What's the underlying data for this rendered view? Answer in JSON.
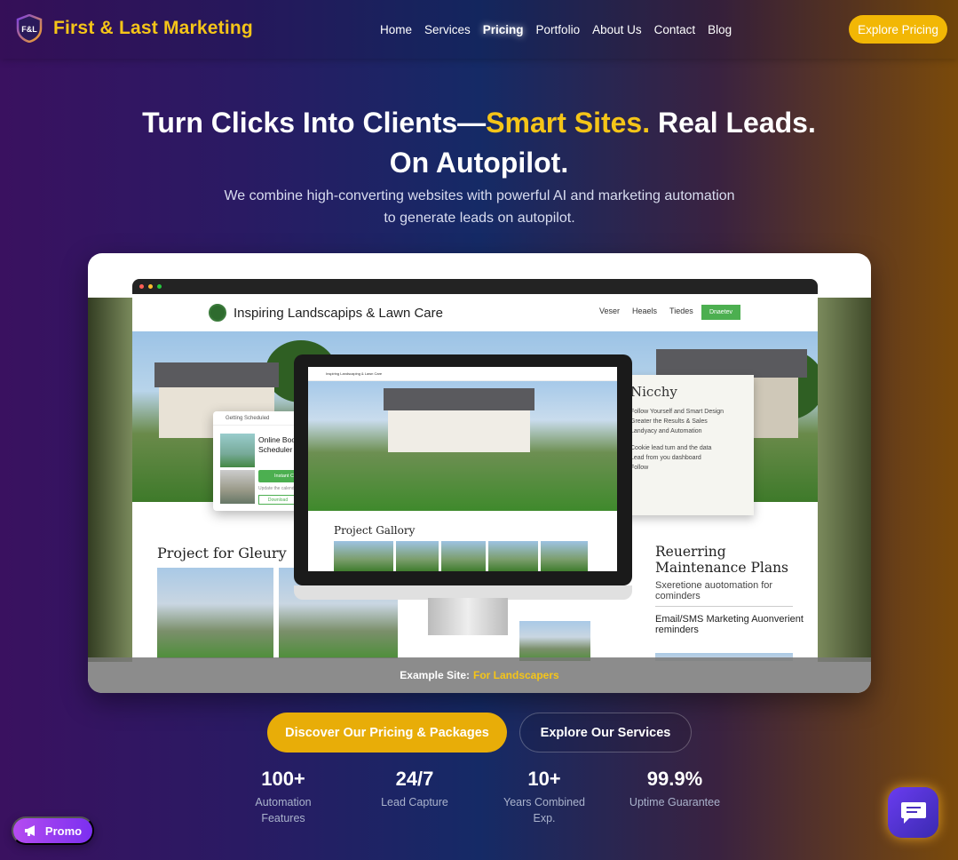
{
  "brand": {
    "name": "First & Last Marketing",
    "logo_text": "F&L"
  },
  "nav": {
    "links": [
      "Home",
      "Services",
      "Pricing",
      "Portfolio",
      "About Us",
      "Contact",
      "Blog"
    ],
    "active": "Pricing",
    "cta": "Explore Pricing"
  },
  "hero": {
    "title_part1": "Turn Clicks Into Clients—",
    "title_highlight": "Smart Sites.",
    "title_part2": " Real Leads.",
    "title_line2": "On Autopilot.",
    "subtitle_line1": "We combine high-converting websites with powerful AI and marketing automation",
    "subtitle_line2": "to generate leads on autopilot."
  },
  "showcase": {
    "site_name": "Inspiring Landscapips & Lawn Care",
    "site_nav": [
      "Veser",
      "Heaels",
      "Tiedes"
    ],
    "site_btn": "Dnaetev",
    "booking": {
      "title": "Online Booking Consultation Scheduler",
      "header": "Getting Scheduled",
      "green_label": "Instant Confirmed",
      "sub_text": "Update the calendar and dashboard",
      "button": "Download"
    },
    "nicchy": {
      "title": "Nicchy",
      "lines": [
        "Follow Yourself and Smart Design",
        "Greater the Results & Sales",
        "Landyacy and Automation",
        "Cookie lead tum and the data",
        "Lead from you dashboard",
        "Follow"
      ]
    },
    "left_title": "Project for Gleury",
    "gallery_title": "Project Gallory",
    "right_title": "Reuerring Maintenance Plans",
    "right_text1": "Sxeretione auotomation for cominders",
    "right_text2": "Email/SMS Marketing Auonverient reminders",
    "monitor_header": "Inspiring Landscaping & Lawn Care",
    "caption_prefix": "Example Site:",
    "caption_highlight": "For Landscapers"
  },
  "cta": {
    "primary": "Discover Our Pricing & Packages",
    "secondary": "Explore Our Services"
  },
  "stats": [
    {
      "value": "100+",
      "label": "Automation Features"
    },
    {
      "value": "24/7",
      "label": "Lead Capture"
    },
    {
      "value": "10+",
      "label": "Years Combined Exp."
    },
    {
      "value": "99.9%",
      "label": "Uptime Guarantee"
    }
  ],
  "floating": {
    "promo": "Promo",
    "chat_icon": "chat-icon"
  },
  "colors": {
    "accent": "#f5c518",
    "button": "#e8ad08",
    "green": "#4caf50"
  }
}
